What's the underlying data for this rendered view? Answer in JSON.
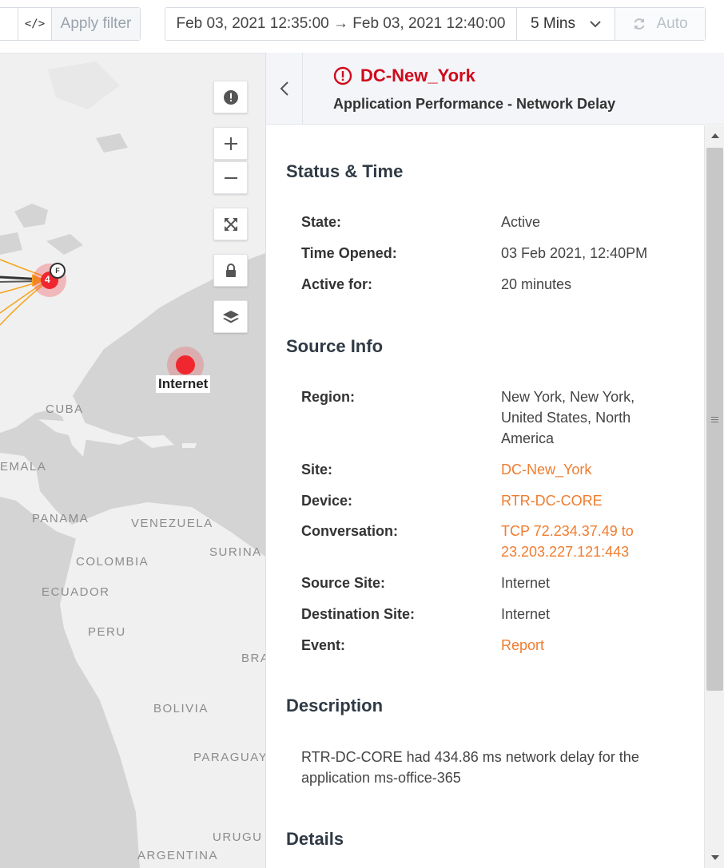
{
  "toolbar": {
    "code_icon_glyph": "</>",
    "apply_filter_label": "Apply filter",
    "time_range": "Feb 03, 2021 12:35:00 → Feb 03, 2021 12:40:00",
    "interval": "5 Mins",
    "auto_label": "Auto"
  },
  "map": {
    "labels": {
      "cuba": "CUBA",
      "guatemala": "EMALA",
      "panama": "PANAMA",
      "venezuela": "VENEZUELA",
      "suriname": "SURINA",
      "colombia": "COLOMBIA",
      "ecuador": "ECUADOR",
      "peru": "PERU",
      "brazil": "BRA",
      "bolivia": "BOLIVIA",
      "paraguay": "PARAGUAY",
      "uruguay": "URUGU",
      "argentina": "ARGENTINA"
    },
    "cluster_count": "4",
    "cluster_badge": "F",
    "internet_label": "Internet",
    "controls": [
      "alert-icon",
      "zoom-in-icon",
      "zoom-out-icon",
      "fit-icon",
      "lock-icon",
      "layers-icon"
    ]
  },
  "panel": {
    "title": "DC-New_York",
    "subtitle": "Application Performance - Network Delay",
    "status": {
      "heading": "Status & Time",
      "state_label": "State:",
      "state_value": "Active",
      "time_opened_label": "Time Opened:",
      "time_opened_value": "03 Feb 2021, 12:40PM",
      "active_for_label": "Active for:",
      "active_for_value": "20 minutes"
    },
    "source": {
      "heading": "Source Info",
      "region_label": "Region:",
      "region_value": "New York, New York, United States, North America",
      "site_label": "Site:",
      "site_value": "DC-New_York",
      "device_label": "Device:",
      "device_value": "RTR-DC-CORE",
      "conversation_label": "Conversation:",
      "conversation_value": "TCP 72.234.37.49 to 23.203.227.121:443",
      "source_site_label": "Source Site:",
      "source_site_value": "Internet",
      "destination_site_label": "Destination Site:",
      "destination_site_value": "Internet",
      "event_label": "Event:",
      "event_value": "Report"
    },
    "description": {
      "heading": "Description",
      "text": "RTR-DC-CORE had 434.86 ms network delay for the application ms-office-365"
    },
    "details": {
      "heading": "Details"
    }
  },
  "colors": {
    "alert_red": "#d0091c",
    "link_orange": "#f07c2f",
    "flow_orange": "#f5a623",
    "marker_red": "#f0272f"
  }
}
